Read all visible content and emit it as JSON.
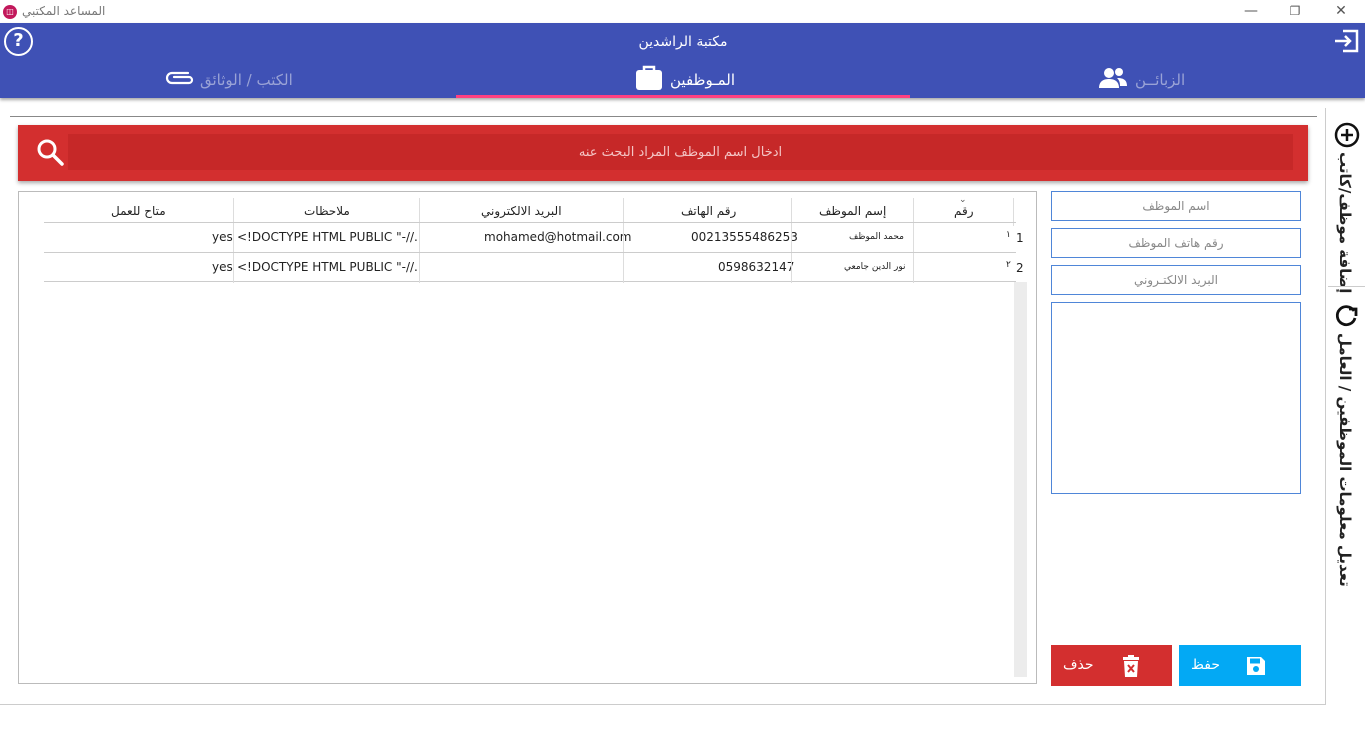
{
  "window": {
    "title": "المساعد المكتبي",
    "app_icon": "app-logo-icon",
    "minimize": "—",
    "restore": "❐",
    "close": "✕"
  },
  "header": {
    "title": "مكتبة الراشدين",
    "help_icon": "?",
    "tabs": [
      {
        "label": "الزبائــن",
        "icon": "users-icon",
        "active": false
      },
      {
        "label": "المـوظفين",
        "icon": "briefcase-icon",
        "active": true
      },
      {
        "label": "الكتب / الوثائق",
        "icon": "paperclip-icon",
        "active": false
      }
    ],
    "accent": "#3f51b5",
    "tab_indicator": "#ff4081"
  },
  "search": {
    "placeholder": "ادخال اسم الموظف المراد البحث عنه",
    "bar_color": "#d32f2f"
  },
  "table": {
    "columns": [
      "رقم",
      "إسم الموظف",
      "رقم الهاتف",
      "البريد الالكتروني",
      "ملاحظات",
      "متاح للعمل"
    ],
    "rows": [
      {
        "row_number": "1",
        "id": "١",
        "name": "محمد الموظف",
        "phone": "00213555486253",
        "email": "mohamed@hotmail.com",
        "notes": "<!DOCTYPE HTML PUBLIC \"-//...",
        "available": "yes"
      },
      {
        "row_number": "2",
        "id": "٢",
        "name": "نور الدين جامعي",
        "phone": "0598632147",
        "email": "",
        "notes": "<!DOCTYPE HTML PUBLIC \"-//...",
        "available": "yes"
      }
    ]
  },
  "form": {
    "name_placeholder": "اسم الموظف",
    "phone_placeholder": "رقم هاتف الموظف",
    "email_placeholder": "البريد الالكتـروني",
    "save_label": "حفظ",
    "delete_label": "حذف",
    "save_color": "#03a9f4",
    "delete_color": "#d32f2f"
  },
  "side_tabs": [
    {
      "label": "إضافة موظف/كاتب",
      "icon": "add-circle-icon"
    },
    {
      "label": "تعديل معلومات الموظفين / العامل",
      "icon": "refresh-icon"
    }
  ]
}
